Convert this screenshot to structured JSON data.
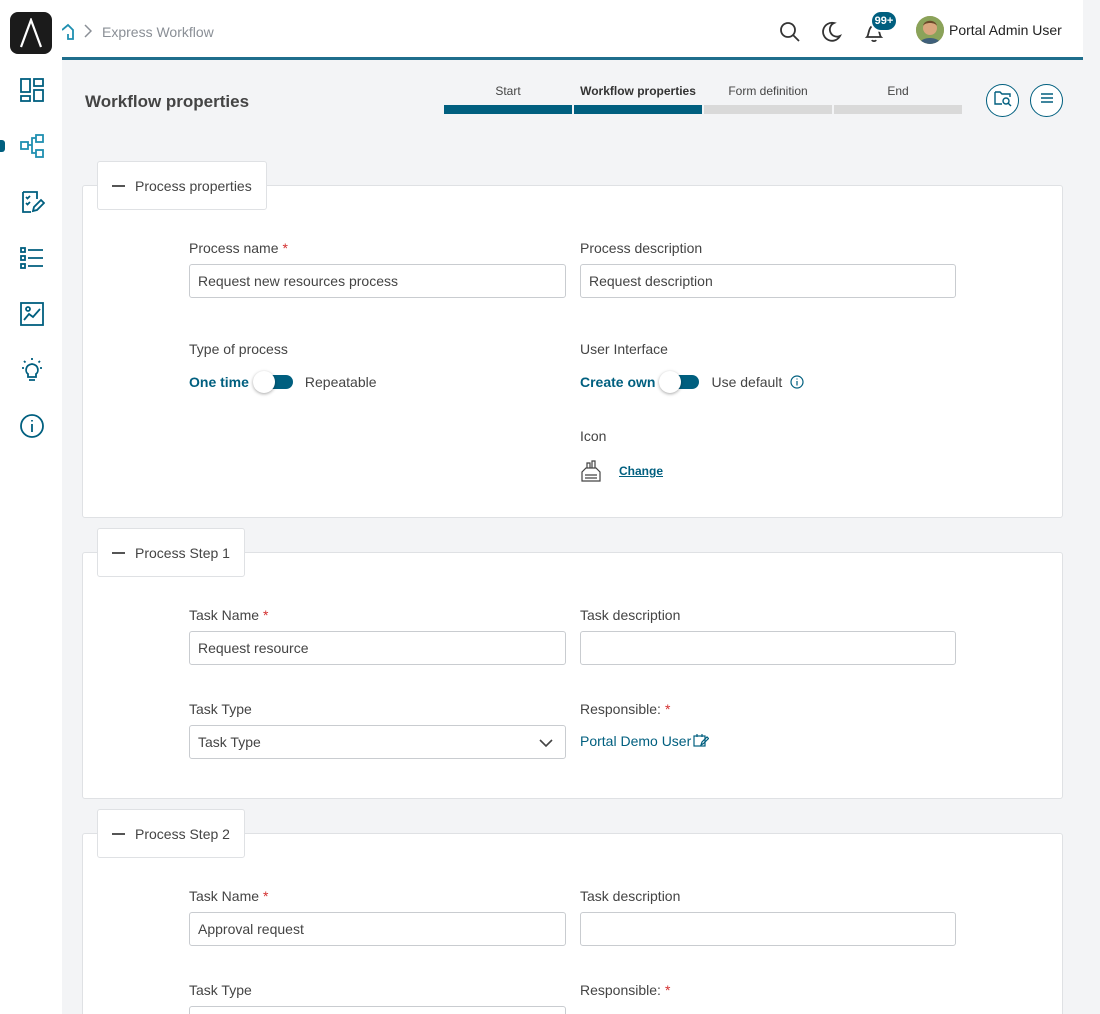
{
  "breadcrumb": {
    "current": "Express Workflow"
  },
  "header": {
    "notifications_badge": "99+",
    "user_name": "Portal Admin User"
  },
  "page": {
    "title": "Workflow properties"
  },
  "steps": [
    {
      "label": "Start",
      "state": "done"
    },
    {
      "label": "Workflow properties",
      "state": "current"
    },
    {
      "label": "Form definition",
      "state": "todo"
    },
    {
      "label": "End",
      "state": "todo"
    }
  ],
  "process_properties": {
    "legend": "Process properties",
    "name_label": "Process name",
    "name_value": "Request new resources process",
    "description_label": "Process description",
    "description_value": "Request description",
    "type_label": "Type of process",
    "type_on": "One time",
    "type_off": "Repeatable",
    "ui_label": "User Interface",
    "ui_on": "Create own",
    "ui_off": "Use default",
    "icon_label": "Icon",
    "icon_change": "Change"
  },
  "process_steps": [
    {
      "legend": "Process Step 1",
      "task_name_label": "Task Name",
      "task_name_value": "Request resource",
      "task_desc_label": "Task description",
      "task_desc_value": "",
      "task_type_label": "Task Type",
      "task_type_value": "Task Type",
      "responsible_label": "Responsible:",
      "responsible_value": "Portal Demo User"
    },
    {
      "legend": "Process Step 2",
      "task_name_label": "Task Name",
      "task_name_value": "Approval request",
      "task_desc_label": "Task description",
      "task_desc_value": "",
      "task_type_label": "Task Type",
      "responsible_label": "Responsible:"
    }
  ],
  "colors": {
    "accent": "#005f7f",
    "required": "#d32f2f"
  }
}
